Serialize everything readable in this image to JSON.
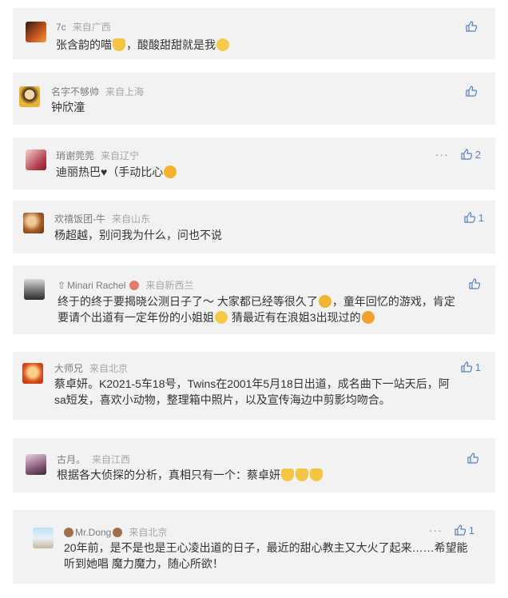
{
  "comments": [
    {
      "name": "7c",
      "location": "来自广西",
      "text_parts": [
        "张含韵的喵",
        "[cat]",
        "，酸酸甜甜就是我",
        "[wink]"
      ],
      "likes": ""
    },
    {
      "name": "名字不够帅",
      "location": "来自上海",
      "text_parts": [
        "钟欣潼"
      ],
      "likes": ""
    },
    {
      "name": "琑谢莞莞",
      "location": "来自辽宁",
      "text_parts": [
        "迪丽热巴♥（手动比心",
        "[love]"
      ],
      "likes": "2",
      "more": "···"
    },
    {
      "name": "欢禧饭团-牛",
      "location": "来自山东",
      "text_parts": [
        "杨超越，别问我为什么，问也不说"
      ],
      "likes": "1"
    },
    {
      "name": "Minari Rachel",
      "location": "来自新西兰",
      "text_line1": "终于的终于要揭晓公测日子了～ 大家都已经等很久了",
      "text_line1b": "，童年回忆的游戏，肯定",
      "text_line2": "要请个出道有一定年份的小姐姐",
      "text_line2b": " 猜最近有在浪姐3出现过的",
      "likes": ""
    },
    {
      "name": "大师兄",
      "location": "来自北京",
      "text_line1": "蔡卓妍。K2021-5车18号，Twins在2001年5月18日出道，成名曲下一站天后，阿",
      "text_line2": "sa短发，喜欢小动物，整理箱中照片，以及宣传海边中剪影均吻合。",
      "likes": "1"
    },
    {
      "name": "古月。",
      "location": "来自江西",
      "text_parts": [
        "根据各大侦探的分析，真相只有一个：蔡卓妍"
      ],
      "likes": ""
    },
    {
      "name": "Mr.Dong",
      "location": "来自北京",
      "text_line1": "20年前，是不是也是王心凌出道的日子，最近的甜心教主又大火了起来……希望能",
      "text_line2": "听到她唱 魔力魔力，随心所欲！",
      "likes": "1",
      "more": "···"
    }
  ],
  "colors": {
    "card_bg": "#f2f2f2",
    "accent": "#5a7fb8",
    "name": "#7b7b7b",
    "location": "#a6a6a6",
    "text": "#333333"
  }
}
